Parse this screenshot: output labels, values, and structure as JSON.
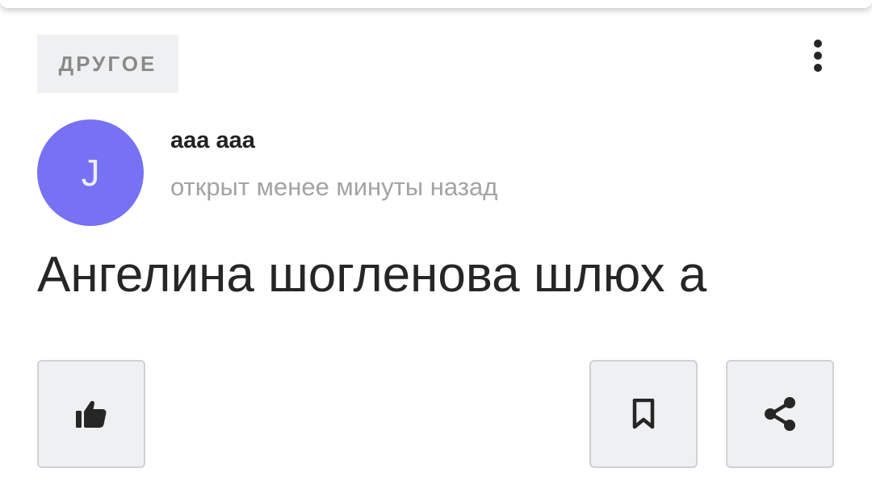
{
  "post": {
    "category": "ДРУГОЕ",
    "author": {
      "initial": "J",
      "name": "aaa aaa",
      "avatar_color": "#7771f4"
    },
    "timestamp": "открыт менее минуты назад",
    "text": "Ангелина шогленова шлюх а"
  },
  "actions": {
    "like_icon": "thumbs-up-icon",
    "bookmark_icon": "bookmark-icon",
    "share_icon": "share-icon",
    "more_icon": "more-vertical-icon"
  },
  "colors": {
    "badge_bg": "#eff0f2",
    "button_bg": "#eff0f2",
    "button_border": "#cfd1d5",
    "icon": "#262626"
  }
}
